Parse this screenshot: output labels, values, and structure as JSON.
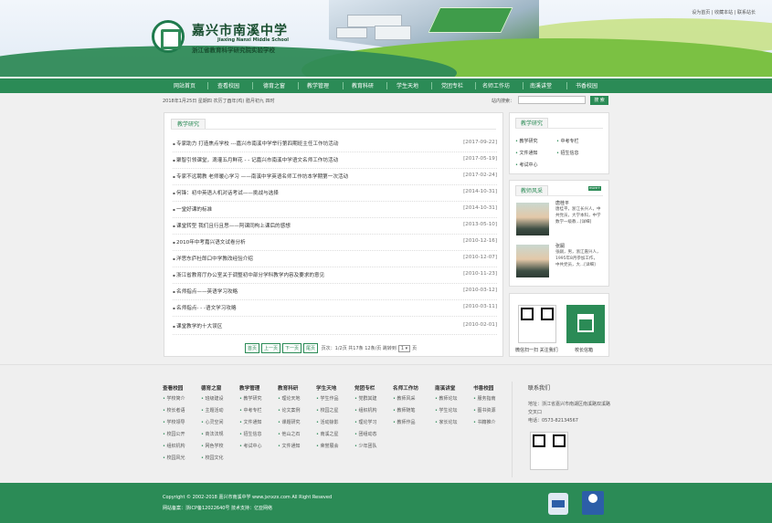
{
  "header": {
    "school_name": "嘉兴市南溪中学",
    "school_en": "Jiaxing Nanxi Middle School",
    "subtitle": "浙江省教育科学研究院实验学校",
    "top_links": "设为首页 | 收藏本站 | 联系站长"
  },
  "nav": [
    "网站首页",
    "查看校园",
    "德育之窗",
    "教学管理",
    "教育科研",
    "学生天地",
    "党团专栏",
    "名师工作坊",
    "南溪讲堂",
    "书香校园"
  ],
  "info": {
    "date": "2018年1月25日 星期四 农历丁酉年(鸡) 腊月初九 四时",
    "search_label": "站内搜索：",
    "search_placeholder": "",
    "search_button": "搜 索"
  },
  "main": {
    "tab": "教学研究",
    "rows": [
      {
        "title": "专家助力 打造焦点学校 ---嘉兴市南溪中学举行第四期班主任工作坊活动",
        "date": "[2017-09-22]"
      },
      {
        "title": "聚智引领课堂，滴灌五月鲜花 - - 记嘉兴市南溪中学语文名师工作坊活动",
        "date": "[2017-05-19]"
      },
      {
        "title": "专家不远聘教 老师暖心学习 ——南溪中学英语名师工作坊本学期第一次活动",
        "date": "[2017-02-24]"
      },
      {
        "title": "何锋：初中英语人机对话考试——挑战与选择",
        "date": "[2014-10-31]"
      },
      {
        "title": "一堂好课的标准",
        "date": "[2014-10-31]"
      },
      {
        "title": "课堂转型 我们且行且思——阿课同构上课后的感想",
        "date": "[2013-05-10]"
      },
      {
        "title": "2010年中考嘉兴语文试卷分析",
        "date": "[2010-12-16]"
      },
      {
        "title": "洋思东庐杜郎口中学教改经验介绍",
        "date": "[2010-12-07]"
      },
      {
        "title": "浙江省教育厅办公室关于调整初中部分学科教学内容及要求的意见",
        "date": "[2010-11-23]"
      },
      {
        "title": "名师指点——英语学习攻略",
        "date": "[2010-03-12]"
      },
      {
        "title": "名师指点- - -语文学习攻略",
        "date": "[2010-03-11]"
      },
      {
        "title": "课堂教学的十大误区",
        "date": "[2010-02-01]"
      }
    ],
    "pager": {
      "first": "首页",
      "prev": "上一页",
      "next": "下一页",
      "last": "尾页",
      "info": "页次：1/2页 共17条 12条/页 跳转到",
      "page_select": "1 ▾",
      "page_unit": "页"
    }
  },
  "side1": {
    "tab": "教学研究",
    "links": [
      "教学研究",
      "中考专栏",
      "文件通知",
      "招生信息",
      "考试中心"
    ]
  },
  "side2": {
    "tab": "教师风采",
    "more": "more+",
    "teachers": [
      {
        "name": "唐桂平",
        "desc": "唐桂平，浙江长兴人，中共党员，大学本科，中学数学一级教...[详细]"
      },
      {
        "name": "张嗣",
        "desc": "张嗣，男，浙江嘉兴人，1995年8月参加工作，中共党员，大...[详细]"
      }
    ]
  },
  "side3": {
    "qr_caption": "微信扫一扫 关注我们",
    "msg_caption": "校长信箱"
  },
  "footer": {
    "columns": [
      {
        "title": "查看校园",
        "items": [
          "学校简介",
          "校长者语",
          "学校领导",
          "校园公开",
          "组织机构",
          "校园风光"
        ]
      },
      {
        "title": "德育之窗",
        "items": [
          "班级建设",
          "主题活动",
          "心灵空间",
          "商法法规",
          "网色学校",
          "校园文化"
        ]
      },
      {
        "title": "教学管理",
        "items": [
          "教学研究",
          "中考专栏",
          "文件通知",
          "招生信息",
          "考试中心"
        ]
      },
      {
        "title": "教育科研",
        "items": [
          "理论天地",
          "论文案例",
          "课题研究",
          "他山之石",
          "文件通知"
        ]
      },
      {
        "title": "学生天地",
        "items": [
          "学生作品",
          "校园之星",
          "活动掠影",
          "南溪之星",
          "荣誉展会"
        ]
      },
      {
        "title": "党团专栏",
        "items": [
          "党群其建",
          "组织机构",
          "理论学习",
          "团组动态",
          "少年团队"
        ]
      },
      {
        "title": "名师工作坊",
        "items": [
          "教师风采",
          "教师随笔",
          "教师作品"
        ]
      },
      {
        "title": "南溪讲堂",
        "items": [
          "教师论坛",
          "学生论坛",
          "家长论坛"
        ]
      },
      {
        "title": "书香校园",
        "items": [
          "服务指南",
          "图书资源",
          "书籍推介"
        ]
      }
    ],
    "contact_title": "联系我们",
    "address": "地址：浙江省嘉兴市南湖区南溪路双溪路交叉口",
    "phone": "电话：0573-82134567"
  },
  "bottom": {
    "copyright": "Copyright © 2002-2018 嘉兴市南溪中学 www.jxnxzx.com All Right Reseved",
    "icp": "网站备案：浙ICP备12022640号 技术支持：亿亚网络"
  },
  "colors": {
    "primary": "#2b8b56",
    "light_green": "#7bc143"
  }
}
